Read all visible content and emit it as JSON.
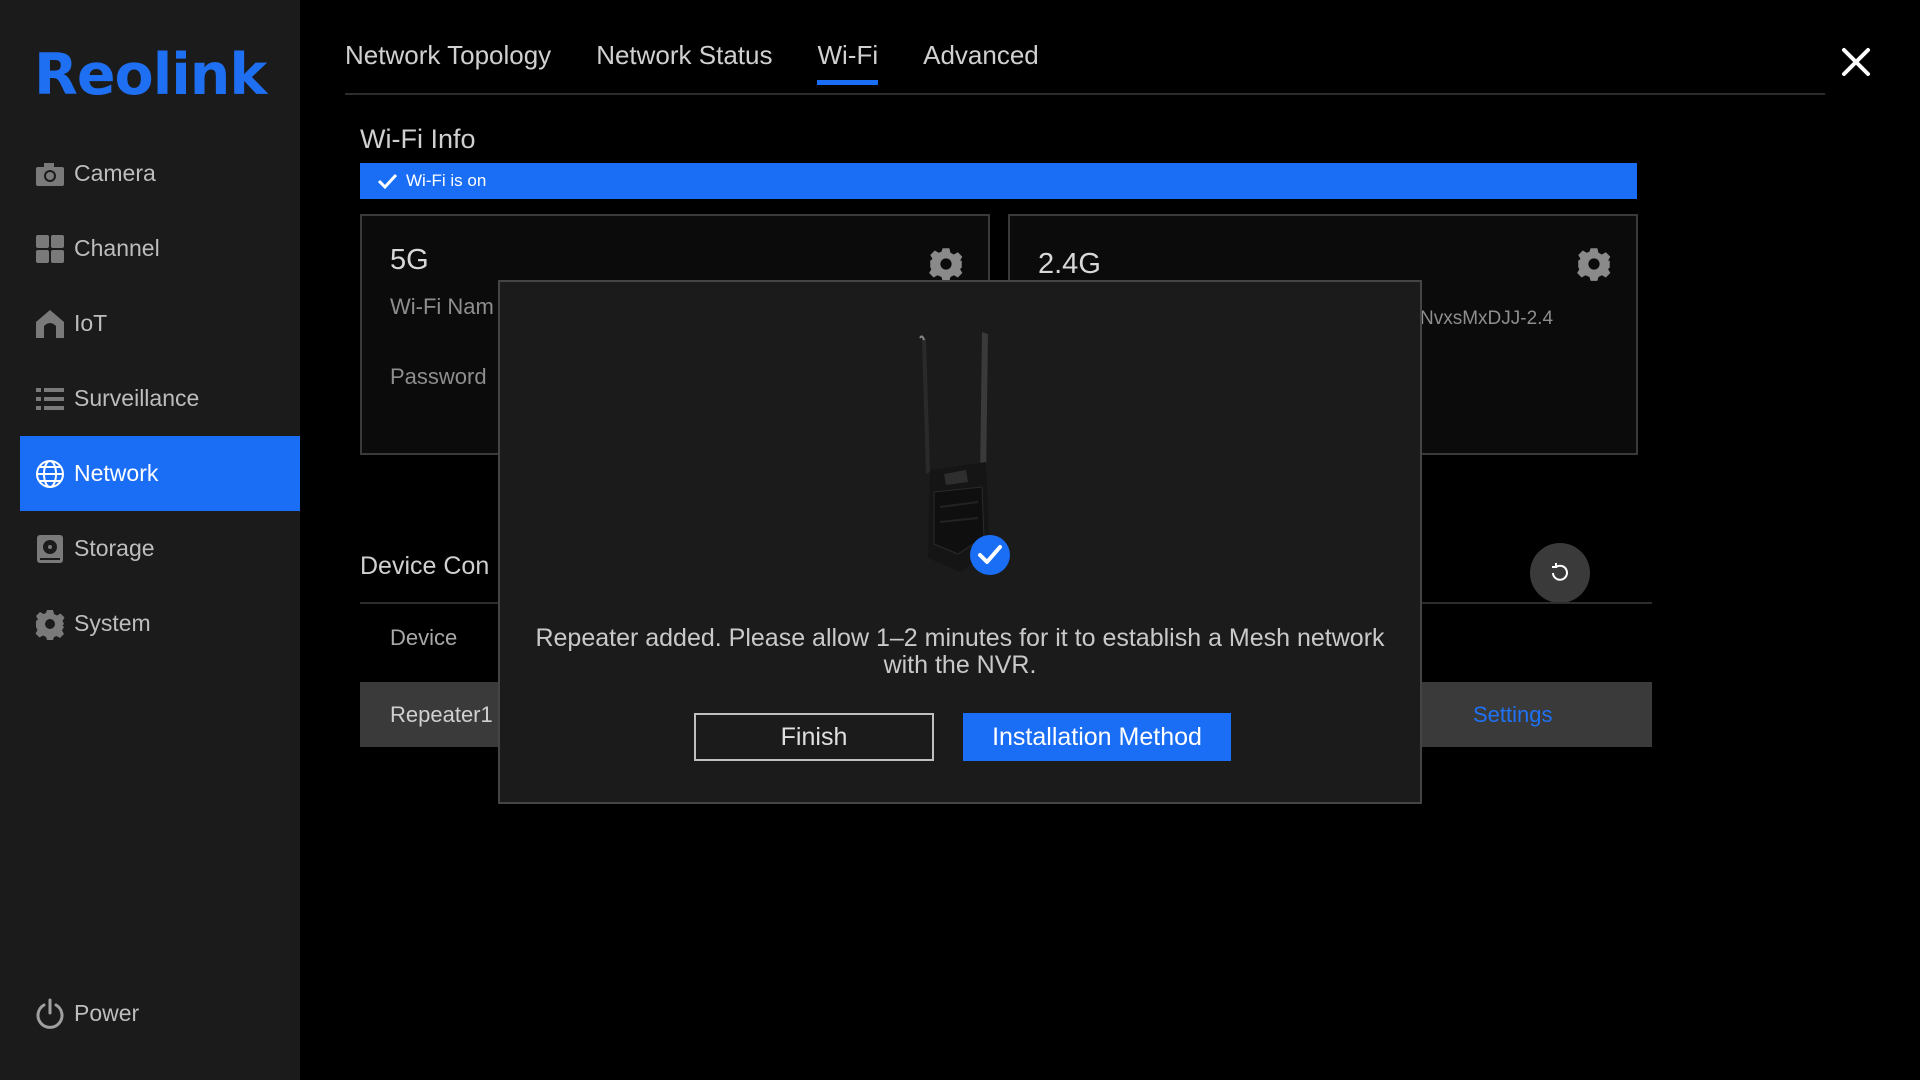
{
  "app": {
    "logo": "Reolink"
  },
  "sidebar": {
    "items": [
      {
        "label": "Camera",
        "icon": "camera-icon"
      },
      {
        "label": "Channel",
        "icon": "channel-grid-icon"
      },
      {
        "label": "IoT",
        "icon": "home-icon"
      },
      {
        "label": "Surveillance",
        "icon": "list-icon"
      },
      {
        "label": "Network",
        "icon": "globe-icon",
        "active": true
      },
      {
        "label": "Storage",
        "icon": "storage-icon"
      },
      {
        "label": "System",
        "icon": "gear-icon"
      }
    ],
    "power_label": "Power"
  },
  "tabs": [
    {
      "label": "Network Topology"
    },
    {
      "label": "Network Status"
    },
    {
      "label": "Wi-Fi",
      "active": true
    },
    {
      "label": "Advanced"
    }
  ],
  "wifi_info": {
    "title": "Wi-Fi Info",
    "status": "Wi-Fi is on",
    "band_5g": {
      "title": "5G",
      "name_label": "Wi-Fi Nam",
      "password_label": "Password"
    },
    "band_24g": {
      "title": "2.4G",
      "name_value": "NvxsMxDJJ-2.4"
    }
  },
  "device_section": {
    "title": "Device Con",
    "column_device": "Device",
    "row_name": "Repeater1",
    "row_action": "Settings"
  },
  "modal": {
    "message": "Repeater added. Please allow 1–2 minutes for it to establish a Mesh network with the NVR.",
    "finish_label": "Finish",
    "install_label": "Installation Method"
  },
  "colors": {
    "accent": "#1a6ef5",
    "sidebar_bg": "#1b1b1b",
    "background": "#000000"
  }
}
